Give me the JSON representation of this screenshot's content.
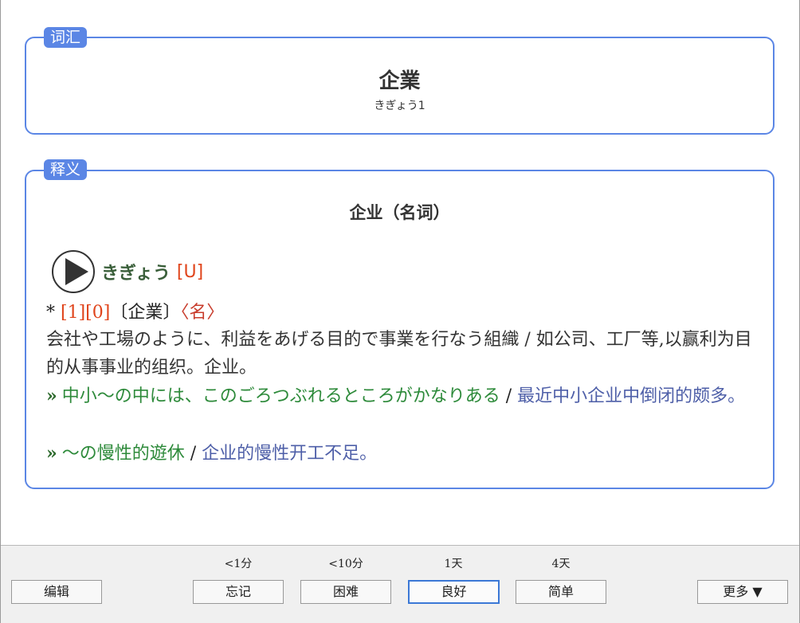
{
  "vocab": {
    "tag": "词汇",
    "word": "企業",
    "reading": "きぎょう1"
  },
  "definition": {
    "tag": "释义",
    "title": "企业（名词）",
    "kana": "きぎょう",
    "level_tag": "[U]",
    "entry": {
      "star": "* ",
      "accent": "[1][0]",
      "kanji": "〔企業〕",
      "pos": "〈名〉"
    },
    "gloss": "会社や工場のように、利益をあげる目的で事業を行なう組織 / 如公司、工厂等,以赢利为目的从事事业的组织。企业。",
    "examples": [
      {
        "bullet": "»",
        "jp": "中小〜の中には、このごろつぶれるところがかなりある",
        "slash": " / ",
        "cn": "最近中小企业中倒闭的颇多。"
      },
      {
        "bullet": "»",
        "jp": "〜の慢性的遊休",
        "slash": " / ",
        "cn": "企业的慢性开工不足。"
      }
    ]
  },
  "bottom_bar": {
    "edit_label": "编辑",
    "more_label": "更多 ▼",
    "answers": [
      {
        "interval": "<1分",
        "label": "忘记"
      },
      {
        "interval": "<10分",
        "label": "困难"
      },
      {
        "interval": "1天",
        "label": "良好"
      },
      {
        "interval": "4天",
        "label": "简单"
      }
    ]
  },
  "icons": {
    "play": "play-icon"
  },
  "colors": {
    "accent_blue": "#5b86e5",
    "example_green": "#2d8a3a",
    "translation_blue": "#4e5fa8",
    "accent_red": "#e0451c"
  }
}
